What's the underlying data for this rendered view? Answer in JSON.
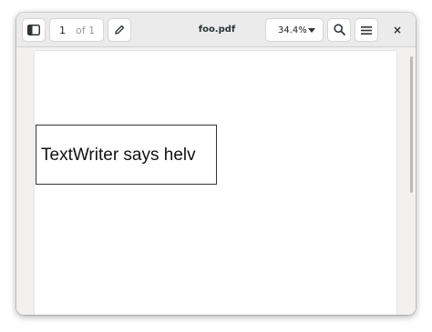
{
  "window": {
    "title": "foo.pdf"
  },
  "toolbar": {
    "sidebar_icon": "sidebar-icon",
    "page_current": "1",
    "page_total": "of 1",
    "annotate_icon": "pencil-icon",
    "zoom_level": "34.4%",
    "search_icon": "search-icon",
    "menu_icon": "hamburger-menu-icon",
    "close_label": "×"
  },
  "document": {
    "text": "TextWriter says helv"
  }
}
